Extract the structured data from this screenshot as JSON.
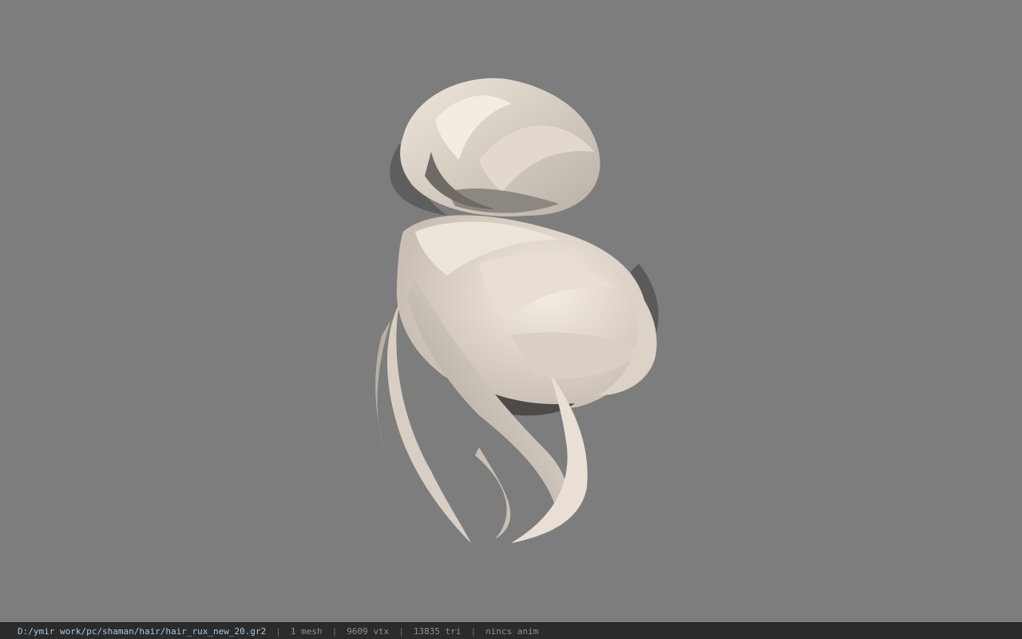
{
  "app": {
    "viewer_background": "#7d7d7d",
    "model_description": "hair-bun-mesh"
  },
  "statusbar": {
    "file_path": "D:/ymir work/pc/shaman/hair/hair_rux_new_20.gr2",
    "separator": "|",
    "mesh_count": "1 mesh",
    "vertex_count": "9609 vtx",
    "triangle_count": "13835 tri",
    "anim_status": "nincs anim",
    "path_color": "#a9c8de",
    "text_color": "#8f8f8f"
  }
}
